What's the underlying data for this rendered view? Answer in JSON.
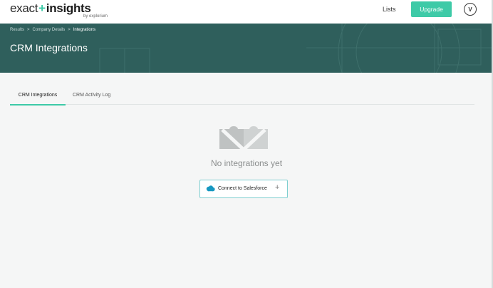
{
  "brand": {
    "word1": "exact",
    "plus": "+",
    "word2": "insights",
    "sub": "by explorium"
  },
  "nav": {
    "lists": "Lists",
    "upgrade": "Upgrade",
    "avatar_initial": "V"
  },
  "breadcrumb": {
    "items": [
      "Results",
      "Company Details",
      "Integrations"
    ],
    "separator": ">"
  },
  "page": {
    "title": "CRM Integrations"
  },
  "tabs": [
    {
      "label": "CRM Integrations",
      "active": true
    },
    {
      "label": "CRM Activity Log",
      "active": false
    }
  ],
  "empty_state": {
    "icon": "puzzle-pieces-icon",
    "message": "No integrations yet",
    "button": {
      "label": "Connect to Salesforce",
      "icon": "salesforce-cloud-icon",
      "trailing_icon": "plus-icon",
      "plus": "+"
    }
  },
  "colors": {
    "accent": "#3ecaa7",
    "banner": "#2f5f5c",
    "salesforce": "#1798c1",
    "background": "#f5f6f6"
  }
}
